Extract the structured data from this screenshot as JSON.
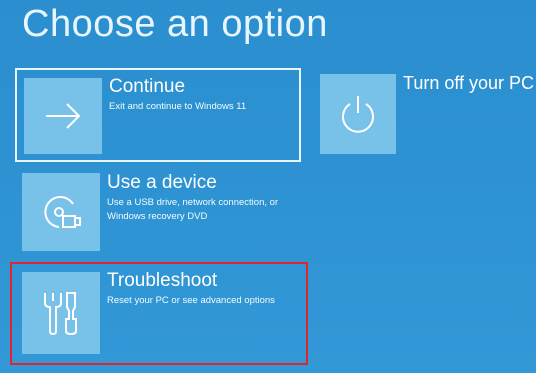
{
  "title": "Choose an option",
  "options": {
    "continue": {
      "label": "Continue",
      "description": "Exit and continue to Windows 11",
      "icon": "arrow-right-icon"
    },
    "power": {
      "label": "Turn off your PC",
      "icon": "power-icon"
    },
    "device": {
      "label": "Use a device",
      "description": "Use a USB drive, network connection, or Windows recovery DVD",
      "icon": "disc-usb-icon"
    },
    "troubleshoot": {
      "label": "Troubleshoot",
      "description": "Reset your PC or see advanced options",
      "icon": "tools-icon",
      "highlighted": true
    }
  },
  "colors": {
    "background": "#2e93d3",
    "tile": "#78c2ea",
    "text": "#ffffff",
    "highlight": "#e0262d"
  }
}
